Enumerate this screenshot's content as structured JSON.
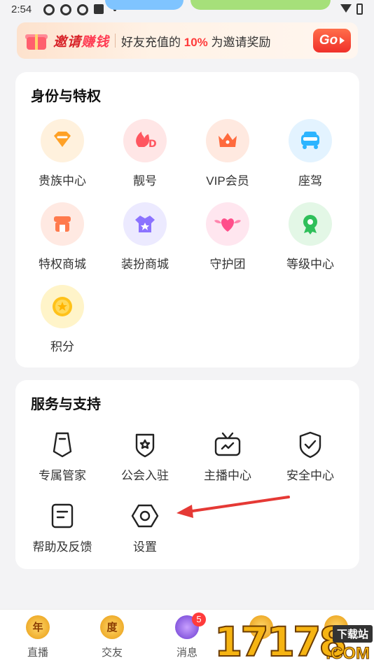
{
  "status_bar": {
    "time": "2:54"
  },
  "banner": {
    "title_a": "邀请",
    "title_b": "赚钱",
    "text_pre": "好友充值的",
    "text_pct": "10%",
    "text_post": "为邀请奖励",
    "go_label": "Go"
  },
  "privileges": {
    "title": "身份与特权",
    "items": [
      {
        "label": "贵族中心",
        "icon": "diamond-icon"
      },
      {
        "label": "靓号",
        "icon": "flame-d-icon"
      },
      {
        "label": "VIP会员",
        "icon": "crown-icon"
      },
      {
        "label": "座驾",
        "icon": "car-icon"
      },
      {
        "label": "特权商城",
        "icon": "shop-icon"
      },
      {
        "label": "装扮商城",
        "icon": "shirt-icon"
      },
      {
        "label": "守护团",
        "icon": "heart-wings-icon"
      },
      {
        "label": "等级中心",
        "icon": "medal-icon"
      },
      {
        "label": "积分",
        "icon": "coin-icon"
      }
    ]
  },
  "services": {
    "title": "服务与支持",
    "items": [
      {
        "label": "专属管家",
        "icon": "butler-icon"
      },
      {
        "label": "公会入驻",
        "icon": "guild-shield-icon"
      },
      {
        "label": "主播中心",
        "icon": "tv-icon"
      },
      {
        "label": "安全中心",
        "icon": "security-shield-icon"
      },
      {
        "label": "帮助及反馈",
        "icon": "help-doc-icon"
      },
      {
        "label": "设置",
        "icon": "settings-hex-icon"
      }
    ]
  },
  "bottom_nav": {
    "items": [
      {
        "label": "直播",
        "glyph": "年"
      },
      {
        "label": "交友",
        "glyph": "度"
      },
      {
        "label": "消息",
        "badge": "5"
      }
    ]
  },
  "watermark": {
    "number": "17178",
    "com": ".COM",
    "tag": "下载站"
  }
}
